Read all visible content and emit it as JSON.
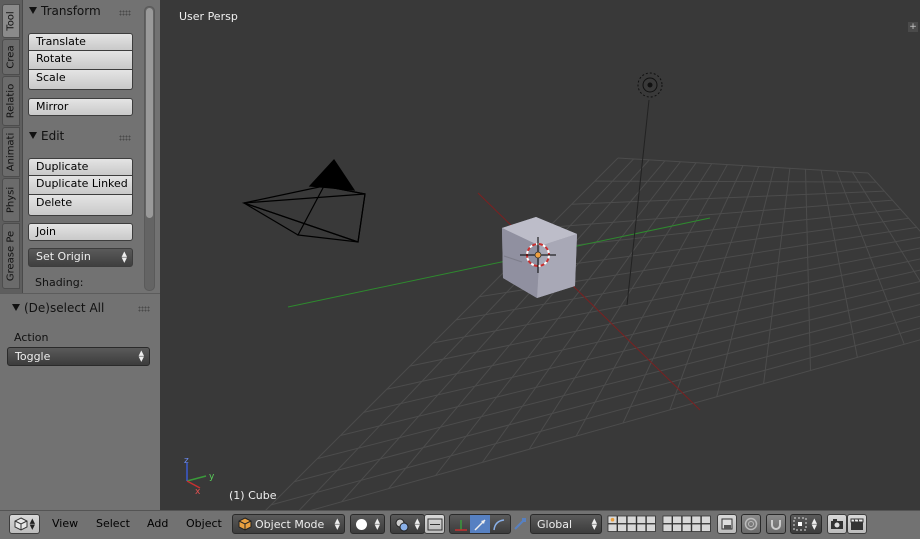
{
  "tool_shelf": {
    "tabs": [
      "Tool",
      "Crea",
      "Relatio",
      "Animati",
      "Physi",
      "Grease Pe"
    ],
    "active_tab": "Tool",
    "transform": {
      "title": "Transform",
      "buttons": [
        "Translate",
        "Rotate",
        "Scale",
        "Mirror"
      ]
    },
    "edit": {
      "title": "Edit",
      "buttons": [
        "Duplicate",
        "Duplicate Linked",
        "Delete",
        "Join"
      ],
      "set_origin": "Set Origin",
      "shading_label": "Shading:"
    }
  },
  "operator_panel": {
    "title": "(De)select All",
    "action_label": "Action",
    "action_value": "Toggle"
  },
  "viewport": {
    "view_name": "User Persp",
    "object_info": "(1) Cube",
    "axis_labels": {
      "x": "x",
      "y": "y",
      "z": "z"
    }
  },
  "header": {
    "menus": [
      "View",
      "Select",
      "Add",
      "Object"
    ],
    "mode": "Object Mode",
    "orientation": "Global",
    "icons": [
      "editor-type-icon",
      "object-mode-cube-icon",
      "viewport-shading-icon",
      "pivot-point-icon",
      "manipulator-toggle-icon",
      "translate-manipulator-icon",
      "rotate-manipulator-icon",
      "scale-manipulator-icon",
      "layers-grid-icon",
      "lock-camera-icon",
      "proportional-editing-icon",
      "snap-magnet-icon",
      "snap-element-icon",
      "render-image-icon",
      "render-animation-icon"
    ]
  },
  "colors": {
    "grid": "#4c4c4c",
    "x_axis": "#7c2020",
    "y_axis": "#2e8a2e",
    "shelf_bg": "#727272",
    "viewport_bg": "#393939",
    "active_manipulator": "#5680c2"
  }
}
